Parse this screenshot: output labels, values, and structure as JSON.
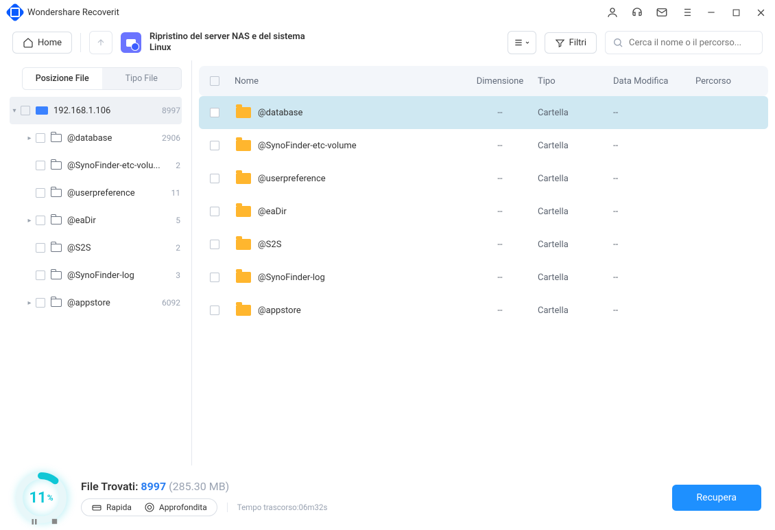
{
  "app": {
    "title": "Wondershare Recoverit"
  },
  "toolbar": {
    "home_label": "Home",
    "context_title": "Ripristino del server NAS e del sistema Linux",
    "filter_label": "Filtri",
    "search_placeholder": "Cerca il nome o il percorso..."
  },
  "sidebar": {
    "tabs": {
      "position": "Posizione File",
      "type": "Tipo File"
    },
    "root": {
      "label": "192.168.1.106",
      "count": "8997"
    },
    "items": [
      {
        "label": "@database",
        "count": "2906",
        "expandable": true
      },
      {
        "label": "@SynoFinder-etc-volu...",
        "count": "2",
        "expandable": false
      },
      {
        "label": "@userpreference",
        "count": "11",
        "expandable": false
      },
      {
        "label": "@eaDir",
        "count": "5",
        "expandable": true
      },
      {
        "label": "@S2S",
        "count": "2",
        "expandable": false
      },
      {
        "label": "@SynoFinder-log",
        "count": "3",
        "expandable": false
      },
      {
        "label": "@appstore",
        "count": "6092",
        "expandable": true
      }
    ]
  },
  "table": {
    "headers": {
      "name": "Nome",
      "dim": "Dimensione",
      "type": "Tipo",
      "mod": "Data Modifica",
      "path": "Percorso"
    },
    "rows": [
      {
        "name": "@database",
        "dim": "--",
        "type": "Cartella",
        "mod": "--",
        "selected": true
      },
      {
        "name": "@SynoFinder-etc-volume",
        "dim": "--",
        "type": "Cartella",
        "mod": "--"
      },
      {
        "name": "@userpreference",
        "dim": "--",
        "type": "Cartella",
        "mod": "--"
      },
      {
        "name": "@eaDir",
        "dim": "--",
        "type": "Cartella",
        "mod": "--"
      },
      {
        "name": "@S2S",
        "dim": "--",
        "type": "Cartella",
        "mod": "--"
      },
      {
        "name": "@SynoFinder-log",
        "dim": "--",
        "type": "Cartella",
        "mod": "--"
      },
      {
        "name": "@appstore",
        "dim": "--",
        "type": "Cartella",
        "mod": "--"
      }
    ]
  },
  "footer": {
    "progress_pct": "11",
    "files_label": "File Trovati:",
    "files_count": "8997",
    "files_size": "(285.30 MB)",
    "mode_quick": "Rapida",
    "mode_deep": "Approfondita",
    "elapsed": "Tempo trascorso:06m32s",
    "recover_label": "Recupera"
  }
}
